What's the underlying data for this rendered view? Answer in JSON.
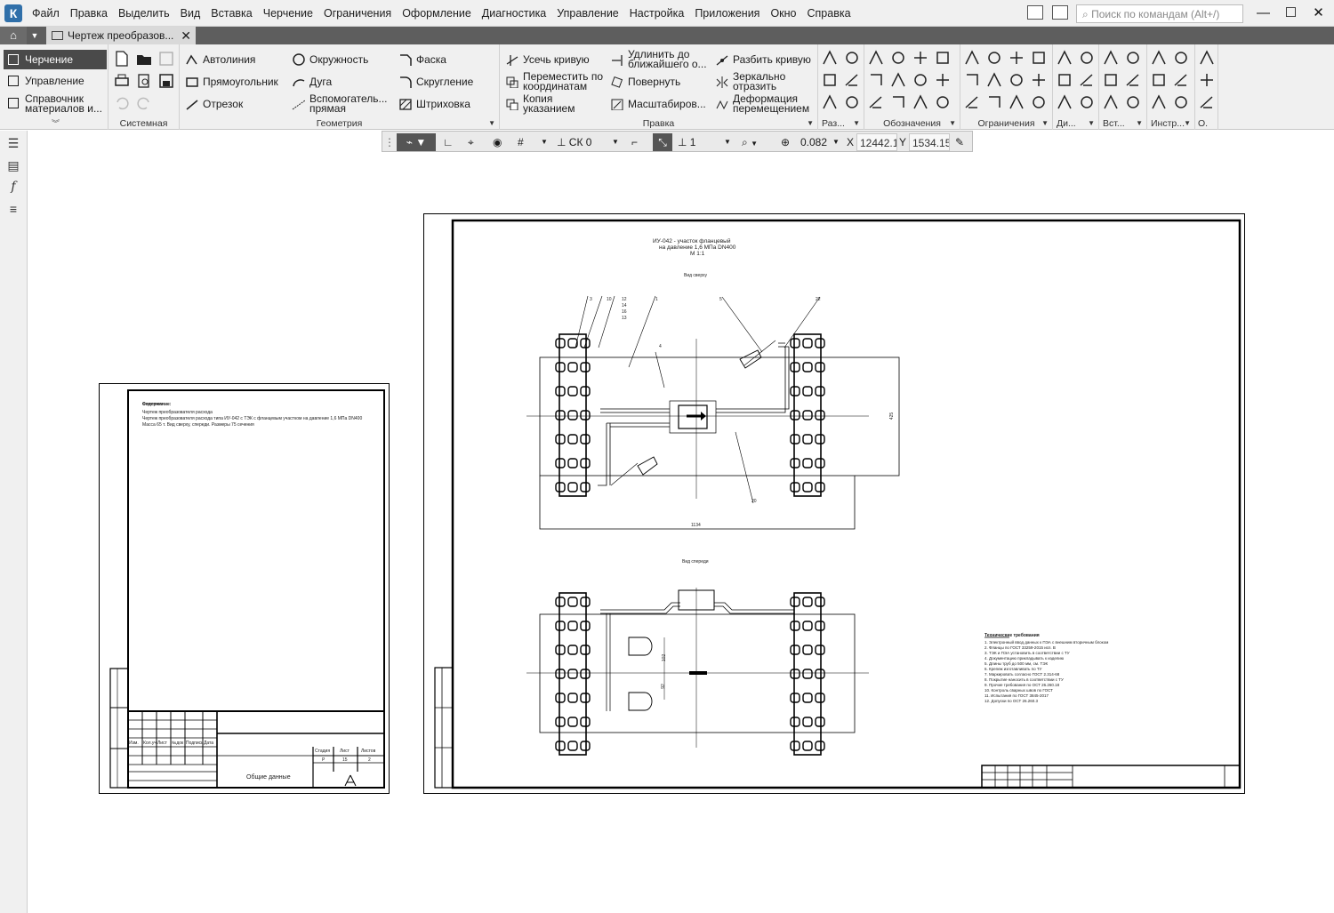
{
  "menu": {
    "items": [
      "Файл",
      "Правка",
      "Выделить",
      "Вид",
      "Вставка",
      "Черчение",
      "Ограничения",
      "Оформление",
      "Диагностика",
      "Управление",
      "Настройка",
      "Приложения",
      "Окно",
      "Справка"
    ],
    "search_placeholder": "Поиск по командам (Alt+/)"
  },
  "tab": {
    "title": "Чертеж преобразов..."
  },
  "modes": {
    "drawing": "Черчение",
    "management": "Управление",
    "reference": "Справочник материалов и..."
  },
  "ribbon": {
    "groups": {
      "system": "Системная",
      "geometry": "Геометрия",
      "edit": "Правка",
      "dims": "Раз...",
      "notation": "Обозначения",
      "constraints": "Ограничения",
      "diag": "Ди...",
      "insert": "Вст...",
      "tools": "Инстр...",
      "other": "О."
    },
    "geometry": {
      "autoline": "Автолиния",
      "circle": "Окружность",
      "chamfer": "Фаска",
      "rectangle": "Прямоугольник",
      "arc": "Дуга",
      "fillet": "Скругление",
      "segment": "Отрезок",
      "aux_line": "Вспомогатель... прямая",
      "hatch": "Штриховка"
    },
    "edit": {
      "trim": "Усечь кривую",
      "extend": "Удлинить до ближайшего о...",
      "split": "Разбить кривую",
      "move_coords": "Переместить по координатам",
      "rotate": "Повернуть",
      "mirror": "Зеркально отразить",
      "copy": "Копия указанием",
      "scale": "Масштабиров...",
      "deform": "Деформация перемещением"
    }
  },
  "coord_bar": {
    "cs": "СК 0",
    "layer": "1",
    "zoom": "0.082",
    "x_label": "X",
    "x_value": "12442.1",
    "y_label": "Y",
    "y_value": "1534.15"
  },
  "sheet_small": {
    "notes_title": "Содержание:",
    "notes": [
      "Чертеж преобразователя расхода",
      "Чертеж преобразователя расхода типа ИУ-042 с ТЭК с фланцевым участком на давление 1,6 МПа DN400",
      "Масса 65 т. Вид сверху, спереди. Размеры 75 сечения"
    ],
    "title": "Общие данные",
    "stage_header": [
      "Стадия",
      "Лист",
      "Листов"
    ],
    "stage_values": [
      "Р",
      "15",
      "2"
    ],
    "header_cells": [
      "Изм.",
      "Кол.уч",
      "Лист",
      "№док",
      "Подпись",
      "Дата"
    ]
  },
  "sheet_large": {
    "title_line1": "ИУ-042 - участок фланцевый",
    "title_line2": "на давление 1,6 МПа DN400",
    "scale": "М 1:1",
    "view_top": "Вид сверху",
    "view_front": "Вид спереди",
    "dim_width": "1134",
    "dim_height": "425",
    "dim_102": "102",
    "dim_92": "92",
    "labels": [
      "3",
      "10",
      "12",
      "14",
      "16",
      "13",
      "1",
      "4",
      "5",
      "22",
      "20"
    ],
    "tech_title": "Технические требования",
    "tech_lines": [
      "1. Электронный ввод данных к ПЭА с внешним вторичным блоком",
      "2. Фланцы по ГОСТ 33259-2015 исп. В",
      "3. ТЭК и ПЭА установить в соответствии с ТУ",
      "4. Документацию прикладывать к изделию",
      "5. Длины труб до 500 мм, см. ТЭК",
      "6. Крепеж изготавливать по ТУ",
      "7. Маркировать согласно ГОСТ 2.314-68",
      "8. Покрытие наносить в соответствии с ТУ",
      "9. Прочие требования по ОСТ 26.260.18",
      "10. Контроль сварных швов по ГОСТ",
      "11. Испытания по ГОСТ 3845-2017",
      "12. Допуски по ОСТ 26.260.3"
    ]
  }
}
